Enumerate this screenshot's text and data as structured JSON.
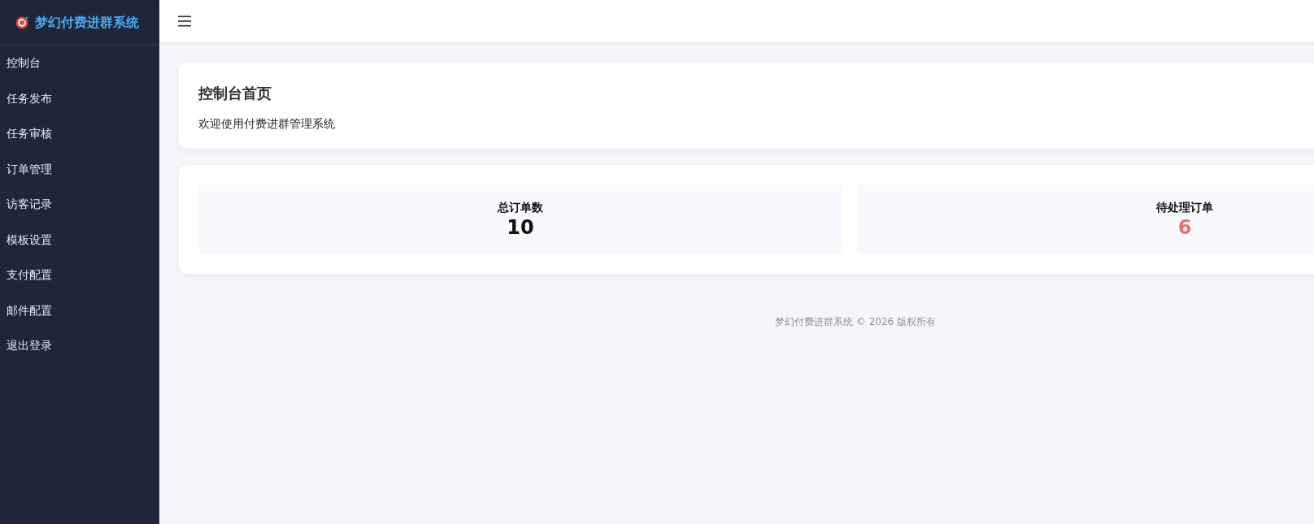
{
  "sidebar": {
    "brand": "梦幻付费进群系统",
    "items": [
      {
        "label": "控制台"
      },
      {
        "label": "任务发布"
      },
      {
        "label": "任务审核"
      },
      {
        "label": "订单管理"
      },
      {
        "label": "访客记录"
      },
      {
        "label": "模板设置"
      },
      {
        "label": "支付配置"
      },
      {
        "label": "邮件配置"
      },
      {
        "label": "退出登录"
      }
    ]
  },
  "welcome_card": {
    "title": "控制台首页",
    "text": "欢迎使用付费进群管理系统"
  },
  "stats": [
    {
      "label": "总订单数",
      "value": "10",
      "color": "#111111"
    },
    {
      "label": "待处理订单",
      "value": "6",
      "color": "#e57373"
    }
  ],
  "footer": "梦幻付费进群系统 © 2026 版权所有"
}
